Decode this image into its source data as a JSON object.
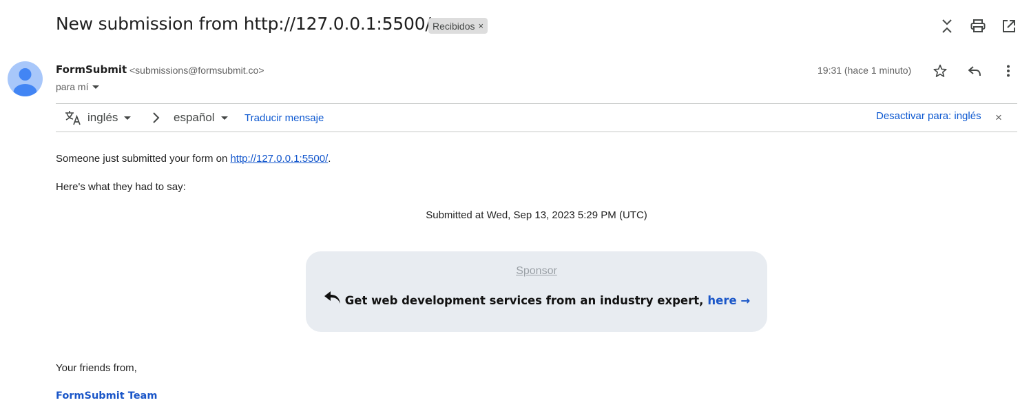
{
  "email": {
    "subject": "New submission from http://127.0.0.1:5500/",
    "label": {
      "text": "Recibidos",
      "remove": "×"
    },
    "sender": {
      "name": "FormSubmit",
      "email": "<submissions@formsubmit.co>",
      "to": "para mí"
    },
    "time": "19:31 (hace 1 minuto)"
  },
  "translation": {
    "from_lang": "inglés",
    "to_lang": "español",
    "translate_link": "Traducir mensaje",
    "disable_link": "Desactivar para: inglés",
    "close": "×"
  },
  "body": {
    "intro_prefix": "Someone just submitted your form on ",
    "intro_link": "http://127.0.0.1:5500/",
    "intro_suffix": ".",
    "says": "Here's what they had to say:",
    "submitted_at": "Submitted at Wed, Sep 13, 2023 5:29 PM (UTC)",
    "sponsor": {
      "label": "Sponsor",
      "text": "Get web development services from an industry expert,",
      "link": "here →"
    },
    "closing": "Your friends from,",
    "team": "FormSubmit Team"
  },
  "icons": [
    "collapse-icon",
    "print-icon",
    "open-in-new-icon",
    "star-icon",
    "reply-icon",
    "more-vert-icon",
    "translate-icon",
    "chevron-right-icon",
    "close-icon",
    "sponsor-reply-icon"
  ],
  "colors": {
    "link_blue": "#0b57d0",
    "avatar_bg": "#a8c7fa",
    "avatar_fg": "#4285f4",
    "sponsor_bg": "#e8ecf1",
    "label_bg": "#dddddd"
  }
}
